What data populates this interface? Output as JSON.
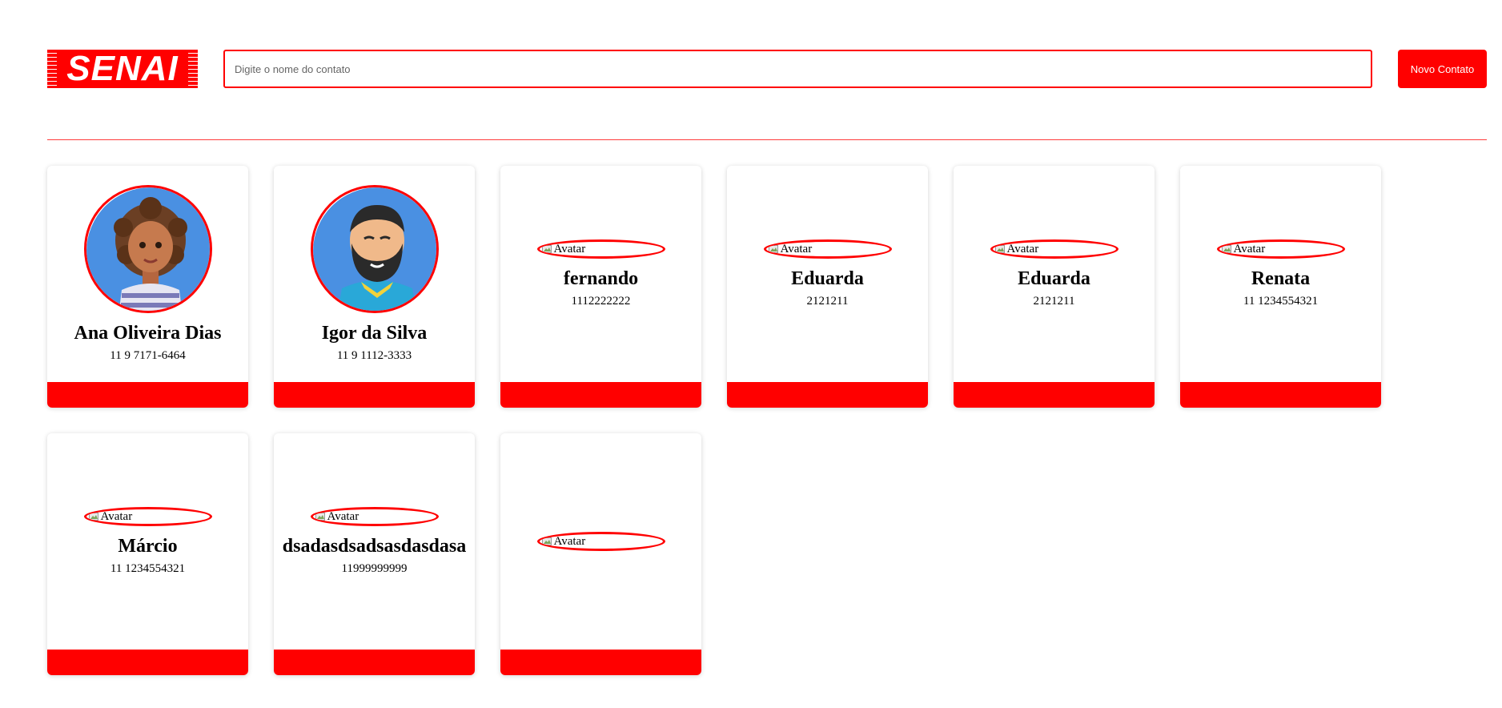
{
  "header": {
    "logo_text": "SENAI",
    "search_placeholder": "Digite o nome do contato",
    "new_contact_label": "Novo Contato"
  },
  "colors": {
    "accent": "#ff0000"
  },
  "contacts": [
    {
      "name": "Ana Oliveira Dias",
      "phone": "11 9 7171-6464",
      "avatar": "woman-curly-hair"
    },
    {
      "name": "Igor da Silva",
      "phone": "11 9 1112-3333",
      "avatar": "man-beard"
    },
    {
      "name": "fernando",
      "phone": "1112222222",
      "avatar_alt": "Avatar"
    },
    {
      "name": "Eduarda",
      "phone": "2121211",
      "avatar_alt": "Avatar"
    },
    {
      "name": "Eduarda",
      "phone": "2121211",
      "avatar_alt": "Avatar"
    },
    {
      "name": "Renata",
      "phone": "11 1234554321",
      "avatar_alt": "Avatar"
    },
    {
      "name": "Márcio",
      "phone": "11 1234554321",
      "avatar_alt": "Avatar"
    },
    {
      "name": "dsadasdsadsasdasdasa",
      "phone": "11999999999",
      "avatar_alt": "Avatar"
    },
    {
      "name": "",
      "phone": "",
      "avatar_alt": "Avatar"
    }
  ]
}
